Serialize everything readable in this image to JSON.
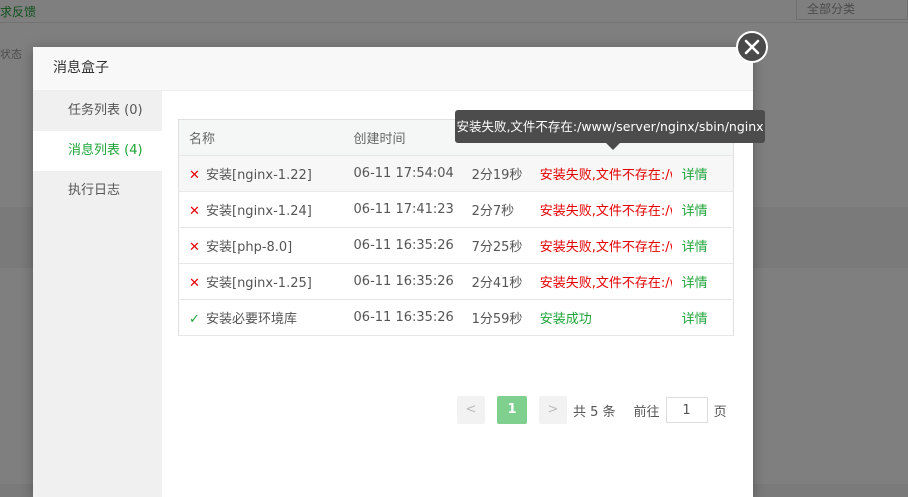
{
  "background": {
    "link_text": "求反馈",
    "select_text": "全部分类",
    "status_text": "状态"
  },
  "modal": {
    "title": "消息盒子",
    "side_items": [
      {
        "label": "任务列表 (0)",
        "active": false
      },
      {
        "label": "消息列表 (4)",
        "active": true
      },
      {
        "label": "执行日志",
        "active": false
      }
    ],
    "table": {
      "headers": [
        "名称",
        "创建时间",
        "",
        "",
        ""
      ],
      "rows": [
        {
          "status": "fail",
          "name": "安装[nginx-1.22]",
          "created": "06-11 17:54:04",
          "duration": "2分19秒",
          "result": "安装失败,文件不存在:/www/server/nginx/sbin/nginx",
          "action": "详情"
        },
        {
          "status": "fail",
          "name": "安装[nginx-1.24]",
          "created": "06-11 17:41:23",
          "duration": "2分7秒",
          "result": "安装失败,文件不存在:/www/server/nginx/sbin/nginx",
          "action": "详情"
        },
        {
          "status": "fail",
          "name": "安装[php-8.0]",
          "created": "06-11 16:35:26",
          "duration": "7分25秒",
          "result": "安装失败,文件不存在:/www/server/nginx/sbin/nginx",
          "action": "详情"
        },
        {
          "status": "fail",
          "name": "安装[nginx-1.25]",
          "created": "06-11 16:35:26",
          "duration": "2分41秒",
          "result": "安装失败,文件不存在:/www/server/nginx/sbin/nginx",
          "action": "详情"
        },
        {
          "status": "success",
          "name": "安装必要环境库",
          "created": "06-11 16:35:26",
          "duration": "1分59秒",
          "result": "安装成功",
          "action": "详情"
        }
      ]
    },
    "pagination": {
      "prev": "<",
      "current": "1",
      "next": ">",
      "total": "共 5 条",
      "goto_label": "前往",
      "goto_value": "1",
      "unit": "页"
    },
    "tooltip": "安装失败,文件不存在:/www/server/nginx/sbin/nginx"
  },
  "colors": {
    "accent": "#20a53a",
    "fail": "#e40000"
  }
}
